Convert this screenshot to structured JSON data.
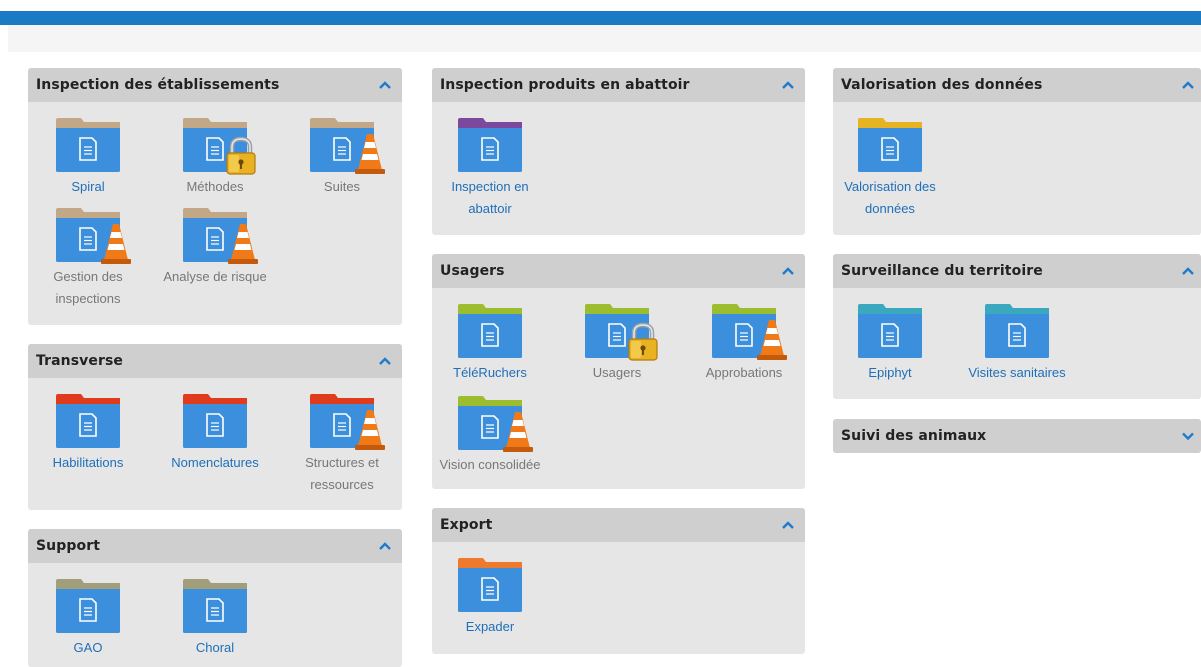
{
  "panels": {
    "inspection_etab": {
      "title": "Inspection des établissements",
      "tiles": [
        {
          "label": "Spiral",
          "tab_color": "#c2a887"
        },
        {
          "label": "Méthodes",
          "tab_color": "#c2a887",
          "overlay": "lock"
        },
        {
          "label": "Suites",
          "tab_color": "#c2a887",
          "overlay": "cone"
        },
        {
          "label": "Gestion des inspections",
          "line1": "Gestion des",
          "line2": "inspections",
          "tab_color": "#c2a887",
          "overlay": "cone"
        },
        {
          "label": "Analyse de risque",
          "tab_color": "#c2a887",
          "overlay": "cone"
        }
      ]
    },
    "transverse": {
      "title": "Transverse",
      "tiles": [
        {
          "label": "Habilitations",
          "tab_color": "#e03b1b"
        },
        {
          "label": "Nomenclatures",
          "tab_color": "#e03b1b"
        },
        {
          "label": "Structures et ressources",
          "line1": "Structures et",
          "line2": "ressources",
          "tab_color": "#e03b1b",
          "overlay": "cone"
        }
      ]
    },
    "support": {
      "title": "Support",
      "tiles": [
        {
          "label": "GAO",
          "tab_color": "#a19f7b"
        },
        {
          "label": "Choral",
          "tab_color": "#a19f7b"
        }
      ]
    },
    "abattoir": {
      "title": "Inspection produits en abattoir",
      "tiles": [
        {
          "label": "Inspection en abattoir",
          "line1": "Inspection en",
          "line2": "abattoir",
          "tab_color": "#7b4a9e"
        }
      ]
    },
    "usagers": {
      "title": "Usagers",
      "tiles": [
        {
          "label": "TéléRuchers",
          "tab_color": "#9bbd2e"
        },
        {
          "label": "Usagers",
          "tab_color": "#9bbd2e",
          "overlay": "lock"
        },
        {
          "label": "Approbations",
          "tab_color": "#9bbd2e",
          "overlay": "cone"
        },
        {
          "label": "Vision consolidée",
          "tab_color": "#9bbd2e",
          "overlay": "cone"
        }
      ]
    },
    "export": {
      "title": "Export",
      "tiles": [
        {
          "label": "Expader",
          "tab_color": "#ef7a2e"
        }
      ]
    },
    "valorisation": {
      "title": "Valorisation des données",
      "tiles": [
        {
          "label": "Valorisation des données",
          "line1": "Valorisation des",
          "line2": "données",
          "tab_color": "#e6b422"
        }
      ]
    },
    "surveillance": {
      "title": "Surveillance du territoire",
      "tiles": [
        {
          "label": "Epiphyt",
          "tab_color": "#3aa9bf"
        },
        {
          "label": "Visites sanitaires",
          "tab_color": "#3aa9bf"
        }
      ]
    },
    "suivi": {
      "title": "Suivi des animaux"
    }
  },
  "colors": {
    "accent": "#1a7ac4",
    "folder_body": "#3b8fdc",
    "link_label": "#1f6fb8",
    "disabled_label": "#777777"
  }
}
